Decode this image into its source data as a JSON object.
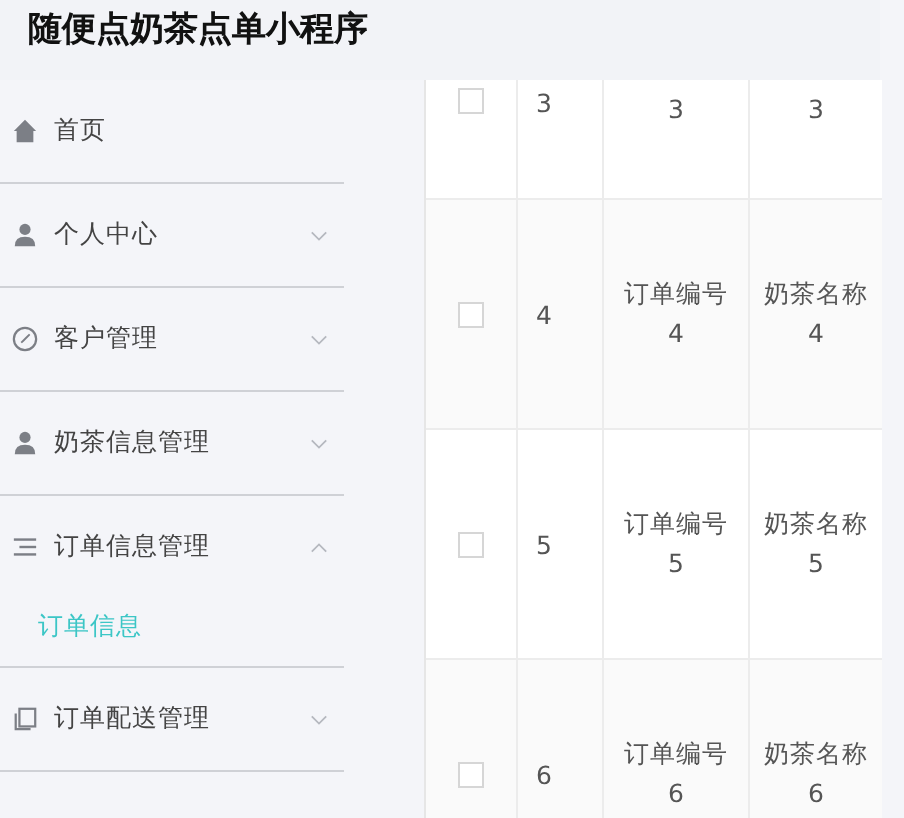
{
  "header": {
    "title": "随便点奶茶点单小程序"
  },
  "sidebar": {
    "items": [
      {
        "label": "首页"
      },
      {
        "label": "个人中心",
        "expanded": false
      },
      {
        "label": "客户管理",
        "expanded": false
      },
      {
        "label": "奶茶信息管理",
        "expanded": false
      },
      {
        "label": "订单信息管理",
        "expanded": true,
        "children": [
          {
            "label": "订单信息",
            "selected": true
          }
        ]
      },
      {
        "label": "订单配送管理",
        "expanded": false
      }
    ]
  },
  "table": {
    "rows": [
      {
        "checked": false,
        "index": "3",
        "cells": [
          [
            "3"
          ],
          [
            "3"
          ]
        ]
      },
      {
        "checked": false,
        "index": "4",
        "cells": [
          [
            "订单编号",
            "4"
          ],
          [
            "奶茶名称",
            "4"
          ]
        ]
      },
      {
        "checked": false,
        "index": "5",
        "cells": [
          [
            "订单编号",
            "5"
          ],
          [
            "奶茶名称",
            "5"
          ]
        ]
      },
      {
        "checked": false,
        "index": "6",
        "cells": [
          [
            "订单编号",
            "6"
          ],
          [
            "奶茶名称",
            "6"
          ]
        ]
      }
    ]
  }
}
